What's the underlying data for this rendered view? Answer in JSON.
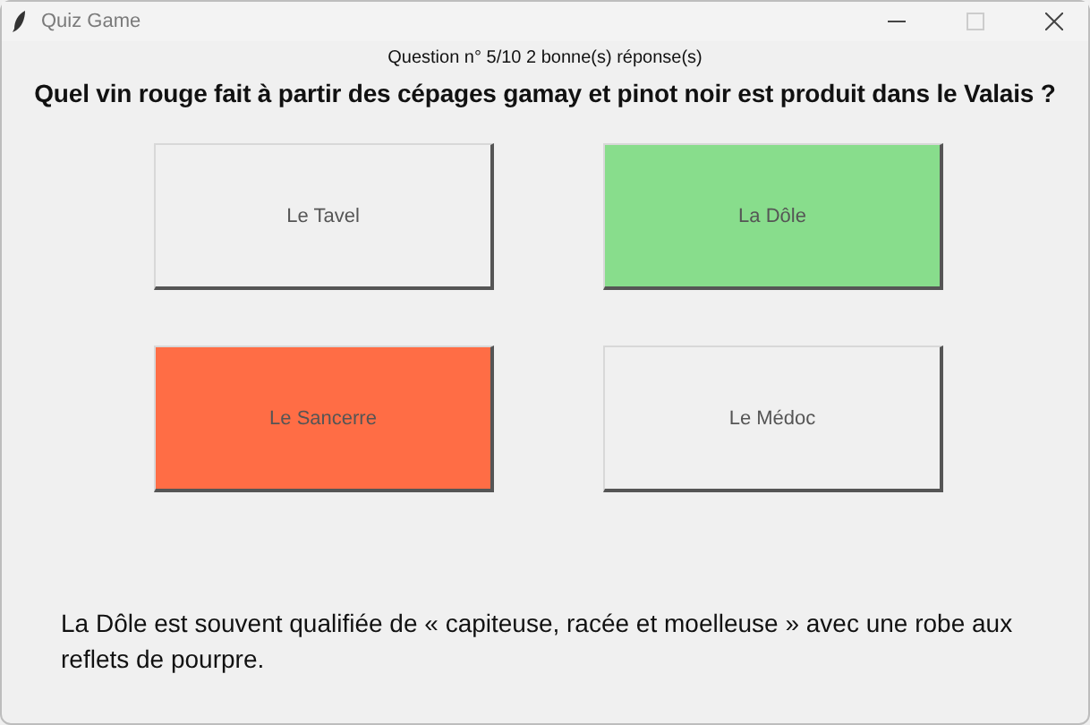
{
  "window": {
    "title": "Quiz Game"
  },
  "progress": "Question n° 5/10 2 bonne(s) réponse(s)",
  "question": "Quel vin rouge fait à partir des cépages gamay et pinot noir est produit dans le Valais ?",
  "answers": [
    {
      "label": "Le Tavel",
      "color": "#f0f0f0"
    },
    {
      "label": "La Dôle",
      "color": "#88dd8c"
    },
    {
      "label": "Le Sancerre",
      "color": "#ff6d45"
    },
    {
      "label": "Le Médoc",
      "color": "#f0f0f0"
    }
  ],
  "explanation": "La Dôle est souvent qualifiée de « capiteuse, racée et moelleuse » avec une robe aux reflets de pourpre."
}
